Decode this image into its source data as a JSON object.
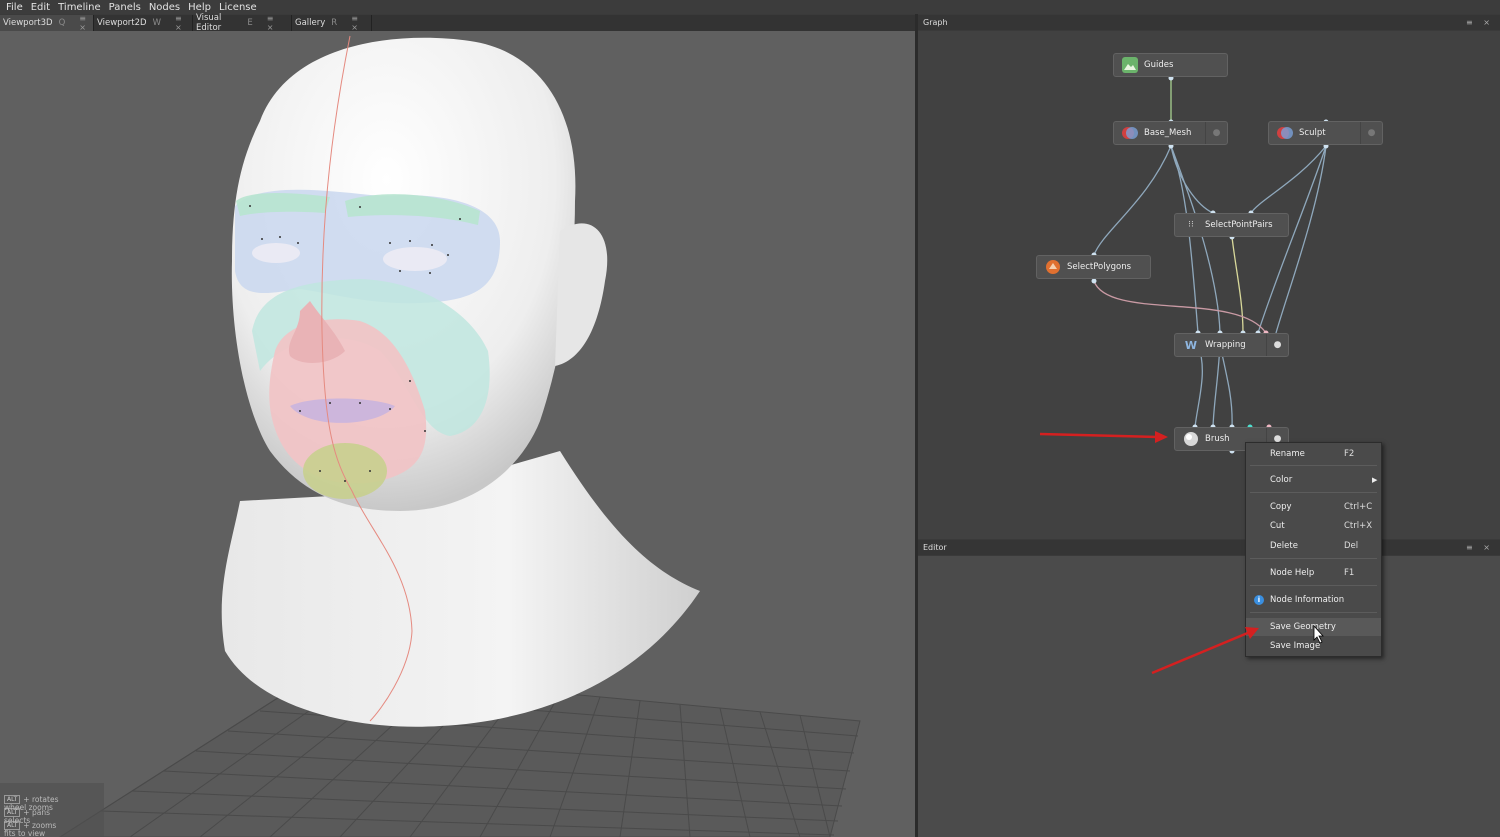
{
  "menu": [
    "File",
    "Edit",
    "Timeline",
    "Panels",
    "Nodes",
    "Help",
    "License"
  ],
  "tabs": [
    {
      "label": "Viewport3D",
      "key": "Q"
    },
    {
      "label": "Viewport2D",
      "key": "W"
    },
    {
      "label": "Visual Editor",
      "key": "E"
    },
    {
      "label": "Gallery",
      "key": "R"
    }
  ],
  "tab_controls": "≡ ×",
  "hints": [
    {
      "key": "ALT",
      "text": "+ rotates"
    },
    {
      "key": "ALT",
      "text": "+ pans"
    },
    {
      "key": "ALT",
      "text": "+ zooms"
    },
    {
      "key": "",
      "text": "wheel zooms"
    },
    {
      "key": "",
      "text": "selects"
    },
    {
      "key": "",
      "text": "fits to view"
    }
  ],
  "graph": {
    "title": "Graph",
    "nodes": {
      "guides": "Guides",
      "base_mesh": "Base_Mesh",
      "sculpt": "Sculpt",
      "select_point_pairs": "SelectPointPairs",
      "select_polygons": "SelectPolygons",
      "wrapping": "Wrapping",
      "brush": "Brush"
    }
  },
  "editor": {
    "title": "Editor"
  },
  "context_menu": {
    "rename": {
      "label": "Rename",
      "shortcut": "F2"
    },
    "color": {
      "label": "Color"
    },
    "copy": {
      "label": "Copy",
      "shortcut": "Ctrl+C"
    },
    "cut": {
      "label": "Cut",
      "shortcut": "Ctrl+X"
    },
    "delete": {
      "label": "Delete",
      "shortcut": "Del"
    },
    "node_help": {
      "label": "Node Help",
      "shortcut": "F1"
    },
    "node_information": {
      "label": "Node Information"
    },
    "save_geometry": {
      "label": "Save Geometry"
    },
    "save_image": {
      "label": "Save Image"
    }
  },
  "colors": {
    "link": "#8fa8bc",
    "link_guides": "#a7d08f",
    "link_yellow": "#d8d89a",
    "link_pink": "#c99aa4",
    "arrow": "#d42020",
    "info_icon": "#3a8fe0"
  }
}
